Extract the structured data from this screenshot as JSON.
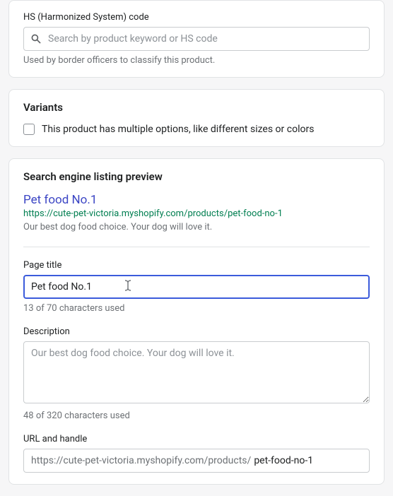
{
  "hs": {
    "label": "HS (Harmonized System) code",
    "placeholder": "Search by product keyword or HS code",
    "help": "Used by border officers to classify this product."
  },
  "variants": {
    "heading": "Variants",
    "checkbox_label": "This product has multiple options, like different sizes or colors"
  },
  "seo": {
    "heading": "Search engine listing preview",
    "preview_title": "Pet food No.1",
    "preview_url": "https://cute-pet-victoria.myshopify.com/products/pet-food-no-1",
    "preview_description": "Our best dog food choice. Your dog will love it.",
    "page_title": {
      "label": "Page title",
      "value": "Pet food No.1",
      "counter": "13 of 70 characters used"
    },
    "description": {
      "label": "Description",
      "placeholder": "Our best dog food choice. Your dog will love it.",
      "counter": "48 of 320 characters used"
    },
    "url_handle": {
      "label": "URL and handle",
      "prefix": "https://cute-pet-victoria.myshopify.com/products/",
      "value": "pet-food-no-1"
    }
  }
}
